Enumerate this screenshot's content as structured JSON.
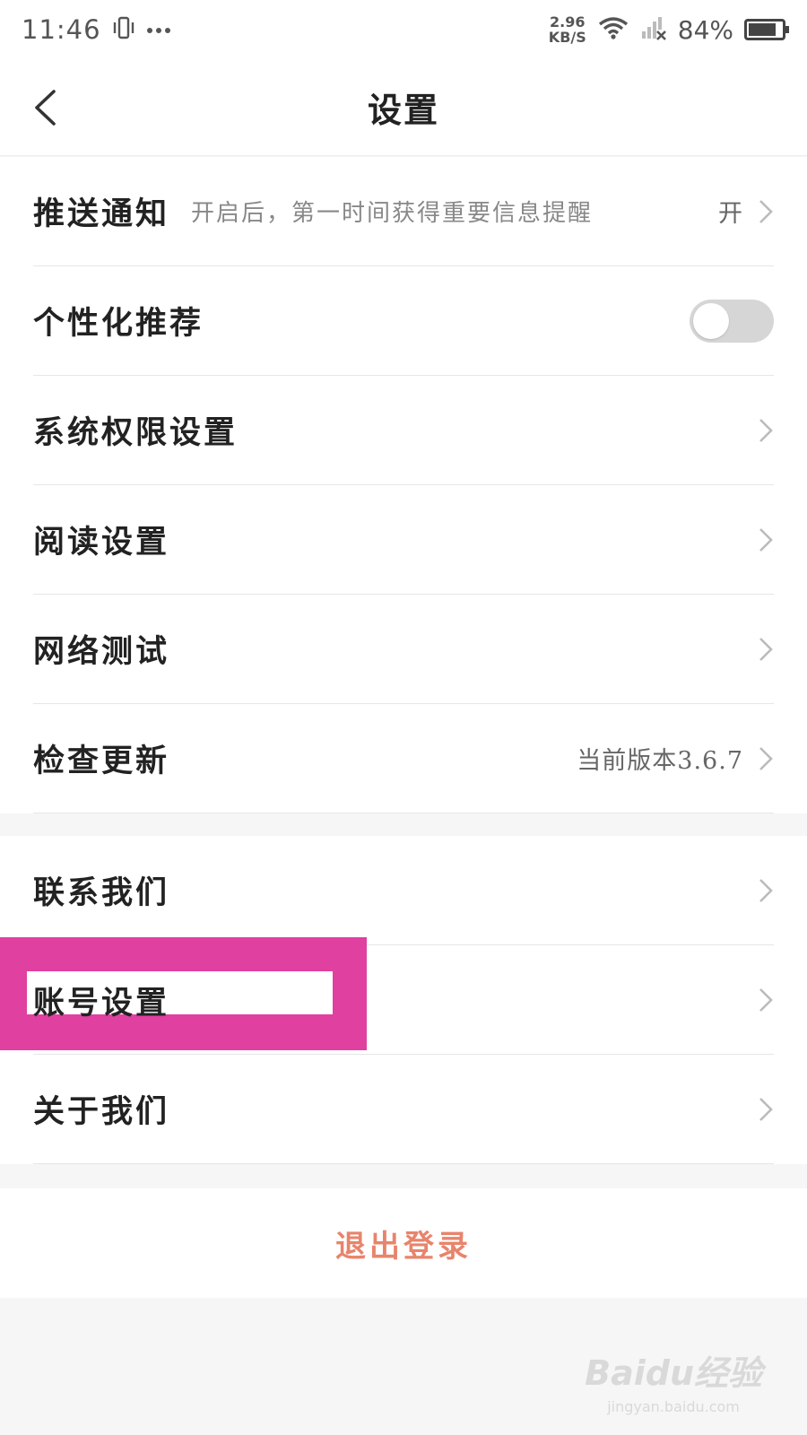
{
  "status_bar": {
    "time": "11:46",
    "net_speed": "2.96",
    "net_unit": "KB/S",
    "battery_percent": "84%",
    "battery_level": 0.84,
    "icons": [
      "vibrate-icon",
      "more-dots-icon",
      "wifi-icon",
      "signal-off-icon",
      "battery-icon"
    ]
  },
  "header": {
    "title": "设置"
  },
  "group1": [
    {
      "label": "推送通知",
      "desc": "开启后，第一时间获得重要信息提醒",
      "value": "开"
    },
    {
      "label": "个性化推荐",
      "toggle": false
    },
    {
      "label": "系统权限设置"
    },
    {
      "label": "阅读设置"
    },
    {
      "label": "网络测试"
    },
    {
      "label": "检查更新",
      "value": "当前版本3.6.7"
    }
  ],
  "group2": [
    {
      "label": "联系我们"
    },
    {
      "label": "账号设置"
    },
    {
      "label": "关于我们"
    }
  ],
  "logout": {
    "label": "退出登录"
  },
  "watermark": {
    "logo": "Baidu经验",
    "url": "jingyan.baidu.com"
  },
  "colors": {
    "logout_text": "#e8846c",
    "highlight": "#e040a0",
    "toggle_off": "#d6d6d6"
  }
}
